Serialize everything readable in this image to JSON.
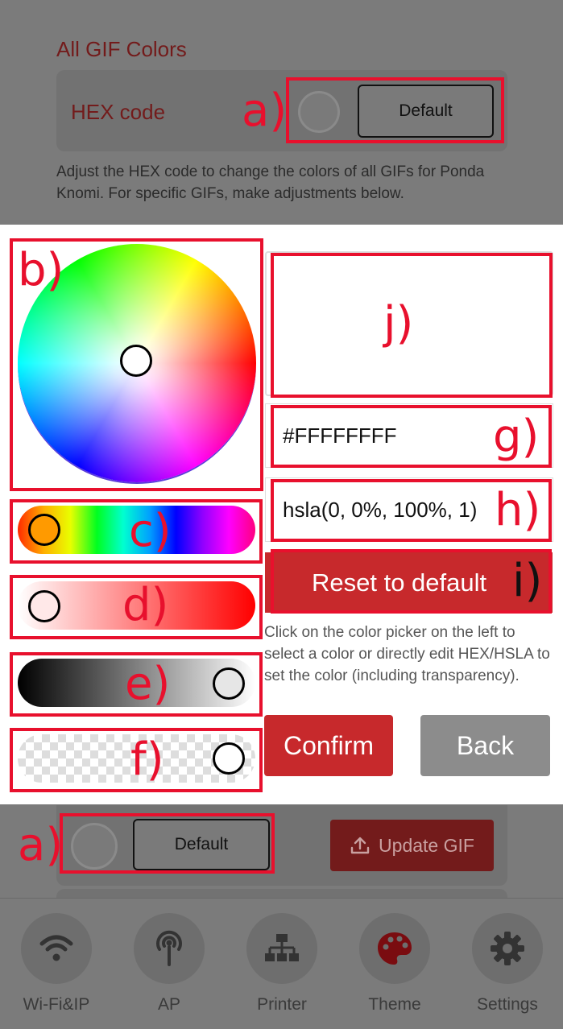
{
  "top": {
    "section_title": "All GIF Colors",
    "hex_label": "HEX code",
    "default_label": "Default",
    "description": "Adjust the HEX code to change the colors of all GIFs for Ponda Knomi. For specific GIFs, make adjustments below."
  },
  "picker": {
    "hex_value": "#FFFFFFFF",
    "hsla_value": "hsla(0, 0%, 100%, 1)",
    "reset_label": "Reset to default",
    "hint": "Click on the color picker on the left to select a color or directly edit HEX/HSLA to set the color (including transparency).",
    "confirm_label": "Confirm",
    "back_label": "Back"
  },
  "gif_row": {
    "default_label": "Default",
    "update_label": "Update GIF"
  },
  "annotations": {
    "a_top": "a)",
    "a_bottom": "a)",
    "b": "b)",
    "c": "c)",
    "d": "d)",
    "e": "e)",
    "f": "f)",
    "g": "g)",
    "h": "h)",
    "i": "i)",
    "j": "j)"
  },
  "tabbar": {
    "items": [
      {
        "label": "Wi-Fi&IP",
        "icon": "wifi-icon"
      },
      {
        "label": "AP",
        "icon": "antenna-icon"
      },
      {
        "label": "Printer",
        "icon": "network-icon"
      },
      {
        "label": "Theme",
        "icon": "palette-icon"
      },
      {
        "label": "Settings",
        "icon": "gear-icon"
      }
    ]
  },
  "colors": {
    "accent_red": "#c7292c",
    "annotation_red": "#e8102d"
  }
}
